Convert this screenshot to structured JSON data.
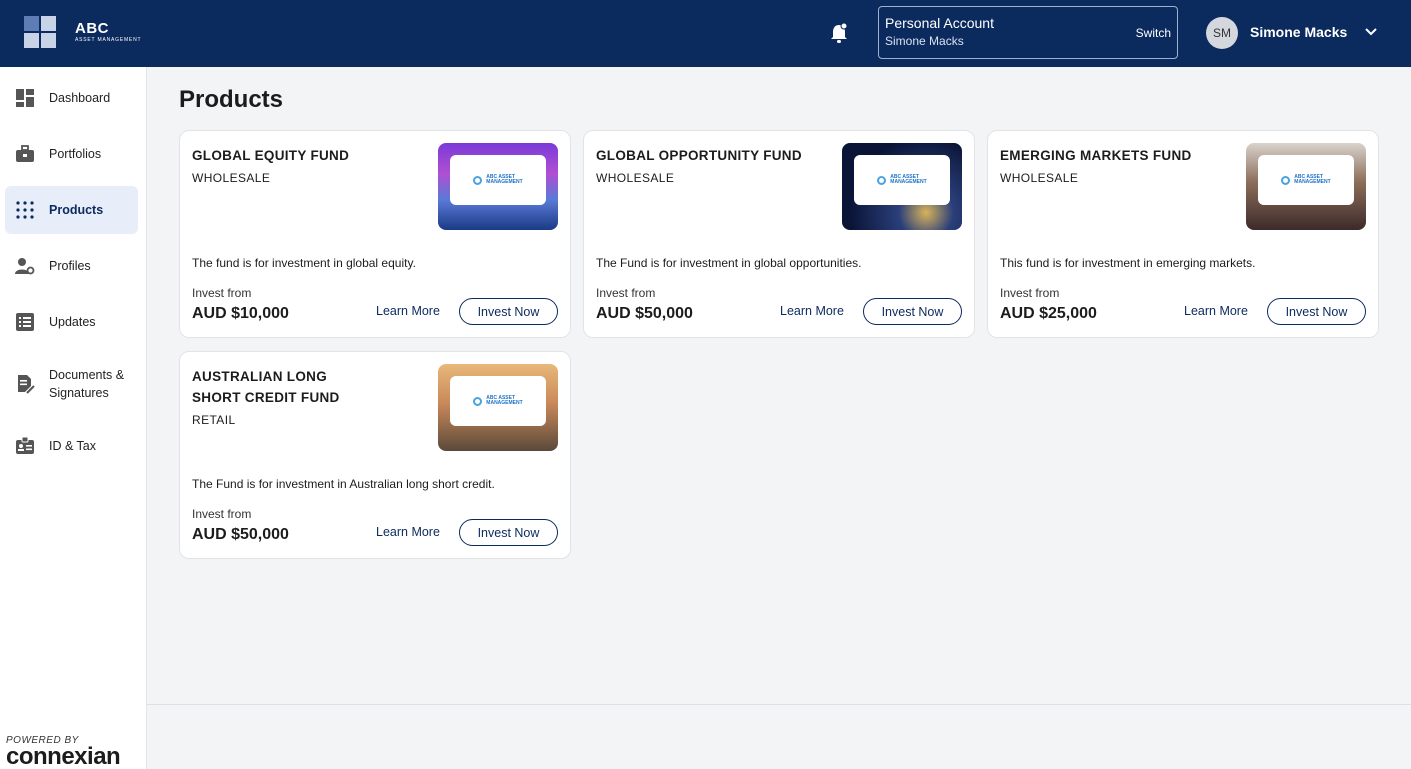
{
  "header": {
    "logo": {
      "name": "ABC",
      "tagline": "ASSET MANAGEMENT"
    },
    "account": {
      "title": "Personal Account",
      "name": "Simone Macks",
      "switch_label": "Switch"
    },
    "user": {
      "initials": "SM",
      "name": "Simone Macks"
    }
  },
  "sidebar": {
    "items": [
      {
        "label": "Dashboard",
        "icon": "dashboard-icon"
      },
      {
        "label": "Portfolios",
        "icon": "briefcase-icon"
      },
      {
        "label": "Products",
        "icon": "dots-grid-icon",
        "active": true
      },
      {
        "label": "Profiles",
        "icon": "user-gear-icon"
      },
      {
        "label": "Updates",
        "icon": "list-icon"
      },
      {
        "label": "Documents & Signatures",
        "icon": "document-sign-icon"
      },
      {
        "label": "ID & Tax",
        "icon": "id-card-icon"
      }
    ],
    "powered_by": "POWERED BY",
    "brand": "connexian"
  },
  "main": {
    "title": "Products",
    "products": [
      {
        "name": "GLOBAL EQUITY FUND",
        "type": "WHOLESALE",
        "description": "The fund is for investment in global equity.",
        "invest_from_label": "Invest from",
        "amount": "AUD $10,000",
        "learn_more": "Learn More",
        "invest_now": "Invest Now"
      },
      {
        "name": "GLOBAL OPPORTUNITY FUND",
        "type": "WHOLESALE",
        "description": "The Fund is for investment in global opportunities.",
        "invest_from_label": "Invest from",
        "amount": "AUD $50,000",
        "learn_more": "Learn More",
        "invest_now": "Invest Now"
      },
      {
        "name": "EMERGING MARKETS FUND",
        "type": "WHOLESALE",
        "description": "This fund is for investment in emerging markets.",
        "invest_from_label": "Invest from",
        "amount": "AUD $25,000",
        "learn_more": "Learn More",
        "invest_now": "Invest Now"
      },
      {
        "name": "AUSTRALIAN LONG SHORT CREDIT FUND",
        "type": "RETAIL",
        "description": "The Fund is for investment in Australian long short credit.",
        "invest_from_label": "Invest from",
        "amount": "AUD $50,000",
        "learn_more": "Learn More",
        "invest_now": "Invest Now"
      }
    ],
    "thumbnail_badge": {
      "line1": "ABC ASSET",
      "line2": "MANAGEMENT"
    }
  },
  "colors": {
    "header": "#0b2a5e",
    "active_nav": "#e7eefa",
    "accent": "#0b2a5e",
    "background": "#f3f4f6"
  }
}
